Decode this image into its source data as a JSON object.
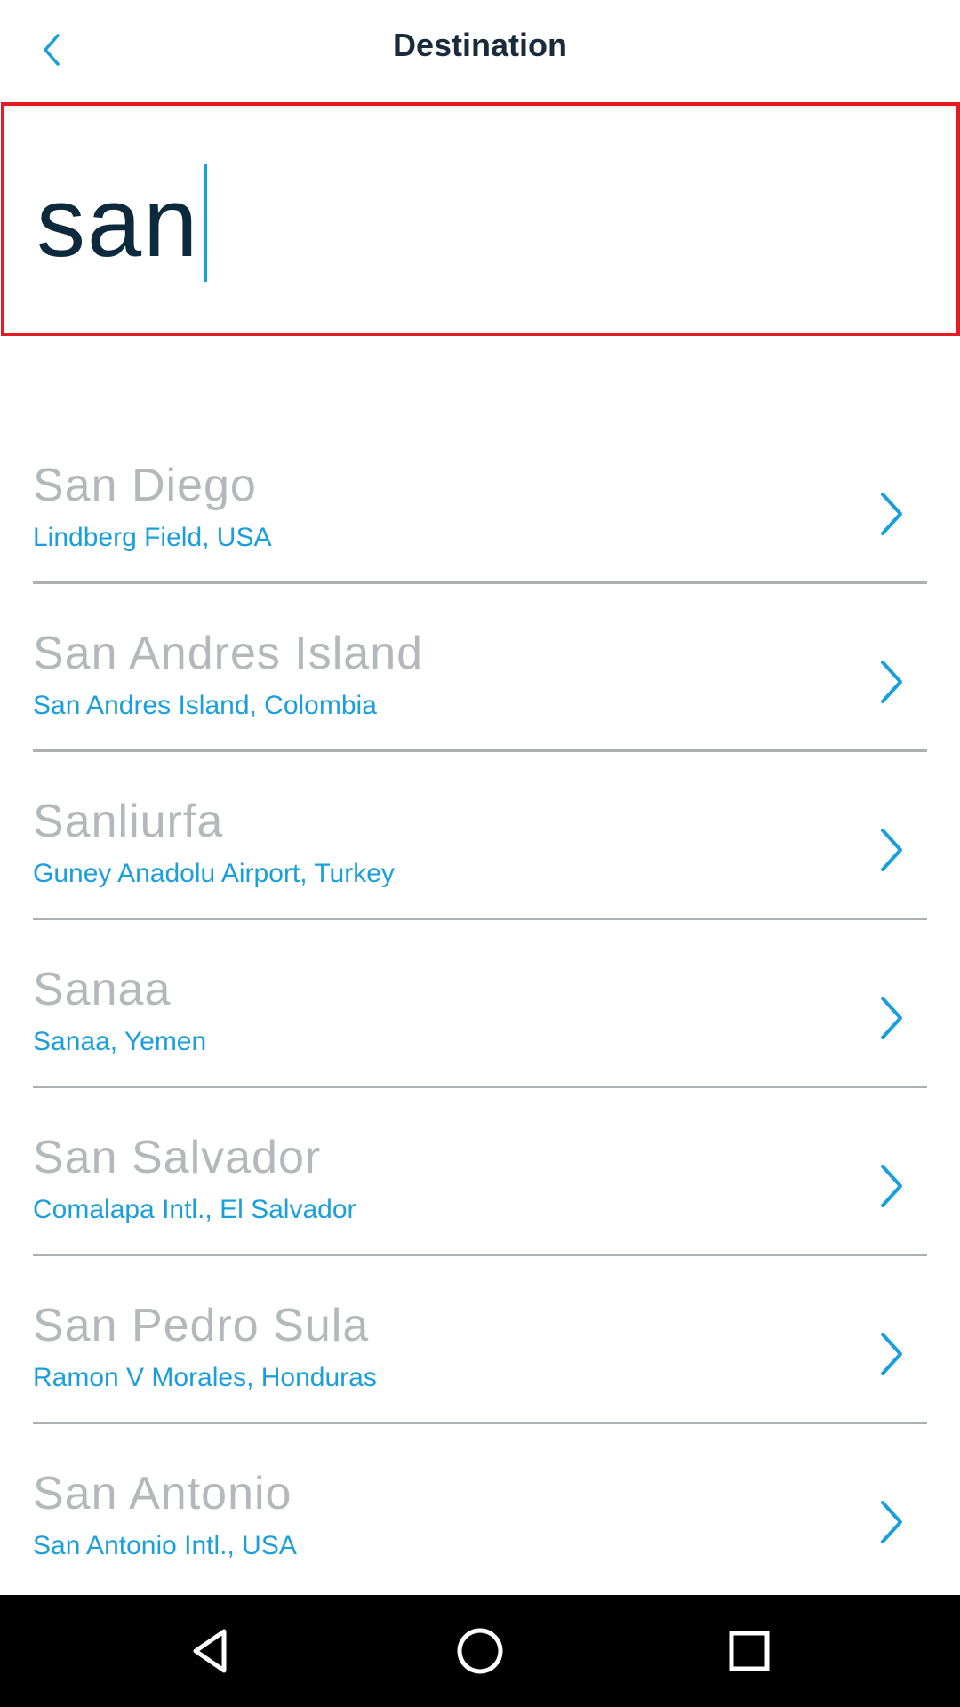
{
  "header": {
    "title": "Destination",
    "back_icon": "chevron-left-icon"
  },
  "search": {
    "value": "san"
  },
  "results": [
    {
      "city": "San Diego",
      "airport": "Lindberg Field, USA"
    },
    {
      "city": "San Andres Island",
      "airport": "San Andres Island, Colombia"
    },
    {
      "city": "Sanliurfa",
      "airport": "Guney Anadolu Airport, Turkey"
    },
    {
      "city": "Sanaa",
      "airport": "Sanaa, Yemen"
    },
    {
      "city": "San Salvador",
      "airport": "Comalapa Intl., El Salvador"
    },
    {
      "city": "San Pedro Sula",
      "airport": "Ramon V Morales, Honduras"
    },
    {
      "city": "San Antonio",
      "airport": "San Antonio Intl., USA"
    }
  ],
  "colors": {
    "accent": "#1a9fdb",
    "highlight_border": "#e31b23",
    "city_text": "#b4b8bb",
    "title_text": "#1a2b3c"
  },
  "navbar": {
    "icons": [
      "back-triangle-icon",
      "home-circle-icon",
      "recents-square-icon"
    ]
  }
}
